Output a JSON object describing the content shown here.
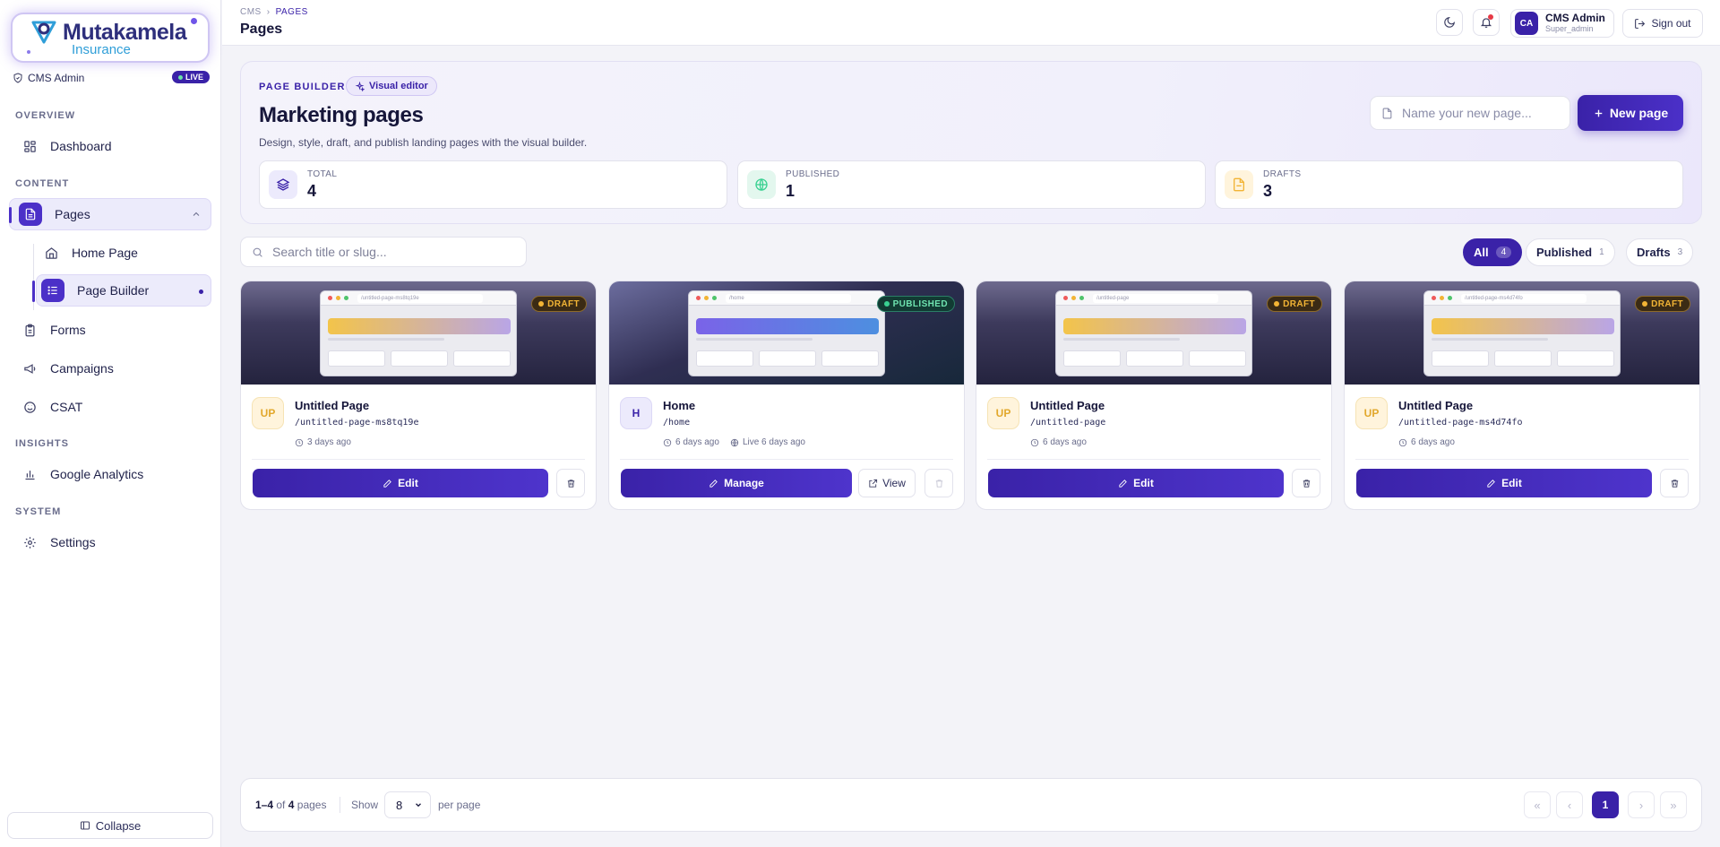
{
  "brand": {
    "name": "Mutakamela",
    "sub": "Insurance"
  },
  "sidebar": {
    "admin_label": "CMS Admin",
    "live_label": "LIVE",
    "sections": {
      "overview": "OVERVIEW",
      "content": "CONTENT",
      "insights": "INSIGHTS",
      "system": "SYSTEM"
    },
    "items": {
      "dashboard": "Dashboard",
      "pages": "Pages",
      "home_page": "Home Page",
      "page_builder": "Page Builder",
      "forms": "Forms",
      "campaigns": "Campaigns",
      "csat": "CSAT",
      "google_analytics": "Google Analytics",
      "settings": "Settings"
    },
    "collapse_label": "Collapse"
  },
  "header": {
    "breadcrumb": [
      "CMS",
      "PAGES"
    ],
    "title": "Pages",
    "user_name": "CMS Admin",
    "user_role": "Super_admin",
    "user_initials": "CA",
    "sign_out": "Sign out"
  },
  "hero": {
    "tag": "PAGE BUILDER",
    "visual_editor": "Visual editor",
    "title": "Marketing pages",
    "description": "Design, style, draft, and publish landing pages with the visual builder.",
    "name_placeholder": "Name your new page...",
    "new_page": "New page",
    "stats": [
      {
        "label": "TOTAL",
        "value": "4"
      },
      {
        "label": "PUBLISHED",
        "value": "1"
      },
      {
        "label": "DRAFTS",
        "value": "3"
      }
    ]
  },
  "toolbar": {
    "search_placeholder": "Search title or slug...",
    "filters": [
      {
        "label": "All",
        "count": "4"
      },
      {
        "label": "Published",
        "count": "1"
      },
      {
        "label": "Drafts",
        "count": "3"
      }
    ]
  },
  "cards": [
    {
      "initials": "UP",
      "title": "Untitled Page",
      "slug": "/untitled-page-ms8tq19e",
      "thumb_url": "/untitled-page-ms8tq19e",
      "status": "DRAFT",
      "time": "3 days ago",
      "action": "Edit"
    },
    {
      "initials": "H",
      "title": "Home",
      "slug": "/home",
      "thumb_url": "/home",
      "status": "PUBLISHED",
      "time": "6 days ago",
      "live": "Live 6 days ago",
      "action": "Manage",
      "view": "View"
    },
    {
      "initials": "UP",
      "title": "Untitled Page",
      "slug": "/untitled-page",
      "thumb_url": "/untitled-page",
      "status": "DRAFT",
      "time": "6 days ago",
      "action": "Edit"
    },
    {
      "initials": "UP",
      "title": "Untitled Page",
      "slug": "/untitled-page-ms4d74fo",
      "thumb_url": "/untitled-page-ms4d74fo",
      "status": "DRAFT",
      "time": "6 days ago",
      "action": "Edit"
    }
  ],
  "pagination": {
    "range": "1–4",
    "of": "of",
    "total": "4",
    "unit": "pages",
    "show": "Show",
    "per_page_value": "8",
    "per_page": "per page",
    "first": "«",
    "prev": "‹",
    "current": "1",
    "next": "›",
    "last": "»"
  },
  "colors": {
    "accent": "#3a22a8",
    "draft": "#f2b435",
    "published": "#3ad192"
  }
}
